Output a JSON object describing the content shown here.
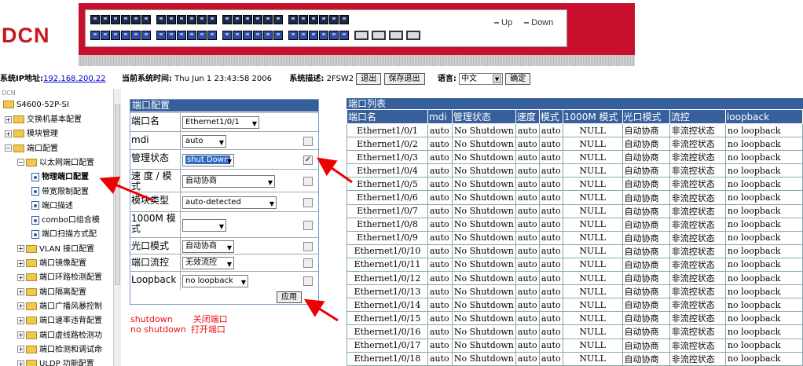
{
  "header": {
    "logo": "DCN",
    "legend_up": "Up",
    "legend_down": "Down",
    "colors": {
      "brand_red": "#c8161d",
      "panel_red": "#c8102e",
      "title_blue": "#365f9c",
      "port_blue": "#2a4da8"
    }
  },
  "sysbar": {
    "ip_label": "系统IP地址:",
    "ip_value": "192.168.200.22",
    "time_label": "当前系统时间:",
    "time_value": "Thu Jun 1 23:43:58 2006",
    "desc_label": "系统描述:",
    "desc_value": "2FSW2",
    "logout_button": "退出",
    "save_logout_button": "保存退出",
    "lang_label": "语言:",
    "lang_value": "中文",
    "confirm_button": "确定"
  },
  "sidebar": {
    "root_caption": "DCN",
    "root": "S4600-52P-SI",
    "items": [
      {
        "label": "交换机基本配置"
      },
      {
        "label": "模块管理"
      },
      {
        "label": "端口配置"
      },
      {
        "label": "以太网端口配置"
      },
      {
        "label": "物理端口配置"
      },
      {
        "label": "带宽限制配置"
      },
      {
        "label": "端口描述"
      },
      {
        "label": "combo口组合模"
      },
      {
        "label": "端口扫描方式配"
      },
      {
        "label": "VLAN 接口配置"
      },
      {
        "label": "端口镜像配置"
      },
      {
        "label": "端口环路检测配置"
      },
      {
        "label": "端口隔离配置"
      },
      {
        "label": "端口广播风暴控制"
      },
      {
        "label": "端口速率违背配置"
      },
      {
        "label": "端口虚线路检测功"
      },
      {
        "label": "端口检测和调试命"
      },
      {
        "label": "ULDP 功能配置"
      }
    ]
  },
  "config": {
    "title": "端口配置",
    "rows": [
      {
        "label": "端口名",
        "value": "Ethernet1/0/1"
      },
      {
        "label": "mdi",
        "value": "auto"
      },
      {
        "label": "管理状态",
        "value": "shut Down",
        "checked": "✓"
      },
      {
        "label": "速 度 / 模 式",
        "value": "自动协商"
      },
      {
        "label": "模块类型",
        "value": "auto-detected"
      },
      {
        "label": "1000M 模 式",
        "value": ""
      },
      {
        "label": "光口模式",
        "value": "自动协商"
      },
      {
        "label": "端口流控",
        "value": "无效流控"
      },
      {
        "label": "Loopback",
        "value": "no loopback"
      }
    ],
    "apply_button": "应用"
  },
  "notes": {
    "line1_cmd": "shutdown",
    "line1_desc": "关闭端口",
    "line2_cmd": "no shutdown",
    "line2_desc": "打开端口"
  },
  "port_list": {
    "title": "端口列表",
    "columns": [
      "端口名",
      "mdi",
      "管理状态",
      "速度",
      "模式",
      "1000M 模式",
      "光口模式",
      "流控",
      "loopback"
    ],
    "rows": [
      [
        "Ethernet1/0/1",
        "auto",
        "No Shutdown",
        "auto",
        "auto",
        "NULL",
        "自动协商",
        "非流控状态",
        "no loopback"
      ],
      [
        "Ethernet1/0/2",
        "auto",
        "No Shutdown",
        "auto",
        "auto",
        "NULL",
        "自动协商",
        "非流控状态",
        "no loopback"
      ],
      [
        "Ethernet1/0/3",
        "auto",
        "No Shutdown",
        "auto",
        "auto",
        "NULL",
        "自动协商",
        "非流控状态",
        "no loopback"
      ],
      [
        "Ethernet1/0/4",
        "auto",
        "No Shutdown",
        "auto",
        "auto",
        "NULL",
        "自动协商",
        "非流控状态",
        "no loopback"
      ],
      [
        "Ethernet1/0/5",
        "auto",
        "No Shutdown",
        "auto",
        "auto",
        "NULL",
        "自动协商",
        "非流控状态",
        "no loopback"
      ],
      [
        "Ethernet1/0/6",
        "auto",
        "No Shutdown",
        "auto",
        "auto",
        "NULL",
        "自动协商",
        "非流控状态",
        "no loopback"
      ],
      [
        "Ethernet1/0/7",
        "auto",
        "No Shutdown",
        "auto",
        "auto",
        "NULL",
        "自动协商",
        "非流控状态",
        "no loopback"
      ],
      [
        "Ethernet1/0/8",
        "auto",
        "No Shutdown",
        "auto",
        "auto",
        "NULL",
        "自动协商",
        "非流控状态",
        "no loopback"
      ],
      [
        "Ethernet1/0/9",
        "auto",
        "No Shutdown",
        "auto",
        "auto",
        "NULL",
        "自动协商",
        "非流控状态",
        "no loopback"
      ],
      [
        "Ethernet1/0/10",
        "auto",
        "No Shutdown",
        "auto",
        "auto",
        "NULL",
        "自动协商",
        "非流控状态",
        "no loopback"
      ],
      [
        "Ethernet1/0/11",
        "auto",
        "No Shutdown",
        "auto",
        "auto",
        "NULL",
        "自动协商",
        "非流控状态",
        "no loopback"
      ],
      [
        "Ethernet1/0/12",
        "auto",
        "No Shutdown",
        "auto",
        "auto",
        "NULL",
        "自动协商",
        "非流控状态",
        "no loopback"
      ],
      [
        "Ethernet1/0/13",
        "auto",
        "No Shutdown",
        "auto",
        "auto",
        "NULL",
        "自动协商",
        "非流控状态",
        "no loopback"
      ],
      [
        "Ethernet1/0/14",
        "auto",
        "No Shutdown",
        "auto",
        "auto",
        "NULL",
        "自动协商",
        "非流控状态",
        "no loopback"
      ],
      [
        "Ethernet1/0/15",
        "auto",
        "No Shutdown",
        "auto",
        "auto",
        "NULL",
        "自动协商",
        "非流控状态",
        "no loopback"
      ],
      [
        "Ethernet1/0/16",
        "auto",
        "No Shutdown",
        "auto",
        "auto",
        "NULL",
        "自动协商",
        "非流控状态",
        "no loopback"
      ],
      [
        "Ethernet1/0/17",
        "auto",
        "No Shutdown",
        "auto",
        "auto",
        "NULL",
        "自动协商",
        "非流控状态",
        "no loopback"
      ],
      [
        "Ethernet1/0/18",
        "auto",
        "No Shutdown",
        "auto",
        "auto",
        "NULL",
        "自动协商",
        "非流控状态",
        "no loopback"
      ]
    ]
  }
}
